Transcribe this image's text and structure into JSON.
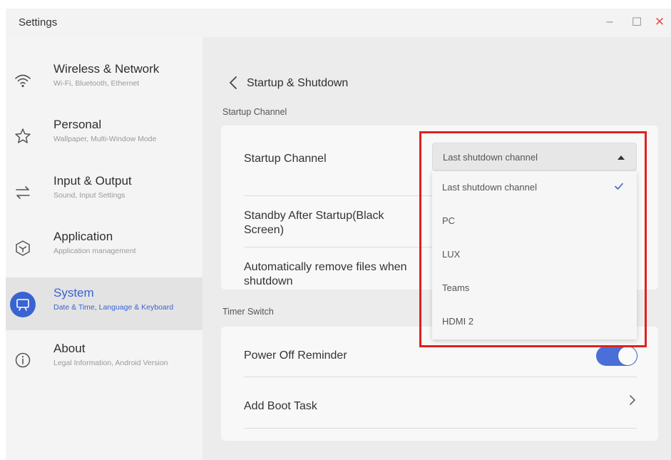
{
  "window": {
    "title": "Settings",
    "controls": {
      "minimize": "–",
      "maximize": "☐",
      "close": "✕"
    }
  },
  "sidebar": {
    "items": [
      {
        "label": "Wireless & Network",
        "sub": "Wi-Fi, Bluetooth, Ethernet",
        "icon": "wifi-icon"
      },
      {
        "label": "Personal",
        "sub": "Wallpaper, Multi-Window Mode",
        "icon": "star-icon"
      },
      {
        "label": "Input & Output",
        "sub": "Sound, Input Settings",
        "icon": "swap-arrows-icon"
      },
      {
        "label": "Application",
        "sub": "Application management",
        "icon": "hexagon-icon"
      },
      {
        "label": "System",
        "sub": "Date & Time, Language & Keyboard",
        "icon": "monitor-icon",
        "active": true
      },
      {
        "label": "About",
        "sub": "Legal Information, Android Version",
        "icon": "info-icon"
      }
    ]
  },
  "main": {
    "title": "Startup & Shutdown",
    "startup_section": {
      "heading": "Startup Channel",
      "rows": [
        {
          "label": "Startup Channel"
        },
        {
          "label": "Standby After Startup(Black Screen)"
        },
        {
          "label": "Automatically remove files when shutdown"
        }
      ]
    },
    "select": {
      "value": "Last shutdown channel",
      "options": [
        "Last shutdown channel",
        "PC",
        "LUX",
        "Teams",
        "HDMI 2"
      ],
      "selected_index": 0
    },
    "timer_section": {
      "heading": "Timer Switch",
      "rows": [
        {
          "label": "Power Off Reminder",
          "toggle_on": true
        },
        {
          "label": "Add Boot Task"
        }
      ]
    }
  },
  "colors": {
    "accent": "#3a63d2",
    "highlight_box": "#e02020",
    "toggle_on": "#4a6fd8"
  }
}
